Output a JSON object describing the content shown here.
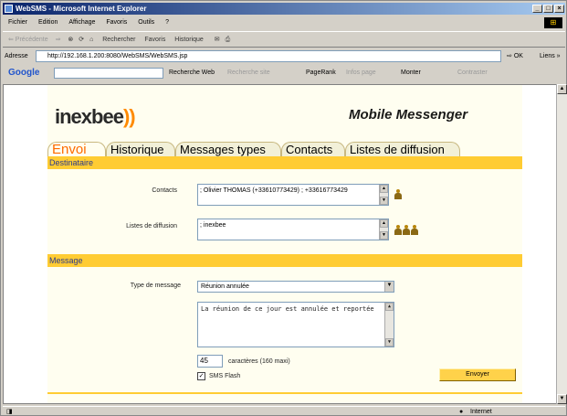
{
  "window": {
    "title": "WebSMS - Microsoft Internet Explorer",
    "minimize": "_",
    "maximize": "□",
    "close": "×"
  },
  "menu": [
    "Fichier",
    "Edition",
    "Affichage",
    "Favoris",
    "Outils",
    "?"
  ],
  "toolbar": {
    "back": "⇐ Précédente",
    "forward": "⇒",
    "search": "Rechercher",
    "favorites": "Favoris",
    "history": "Historique"
  },
  "address": {
    "label": "Adresse",
    "url": "http://192.168.1.200:8080/WebSMS/WebSMS.jsp",
    "go": "OK",
    "links": "Liens »"
  },
  "google": {
    "logo": "Google",
    "search_web": "Recherche Web",
    "search_site": "Recherche site",
    "pagerank": "PageRank",
    "infos": "Infos page",
    "up": "Monter",
    "contrast": "Contraster"
  },
  "page": {
    "brand": "inexbee",
    "brand_suffix": "))",
    "heading": "Mobile Messenger",
    "tabs": [
      "Envoi",
      "Historique",
      "Messages types",
      "Contacts",
      "Listes de diffusion"
    ],
    "sec_dest": "Destinataire",
    "contacts_label": "Contacts",
    "contacts_value": "; Olivier THOMAS (+33610773429) ; +33616773429",
    "lists_label": "Listes de diffusion",
    "lists_value": "; inexbee",
    "sec_msg": "Message",
    "type_label": "Type de message",
    "type_value": "Réunion annulée",
    "message": "La réunion de ce jour est annulée et reportée",
    "count": "45",
    "count_label": "caractères (160 maxi)",
    "flash_label": "SMS Flash",
    "send": "Envoyer"
  },
  "status": {
    "zone": "Internet"
  }
}
